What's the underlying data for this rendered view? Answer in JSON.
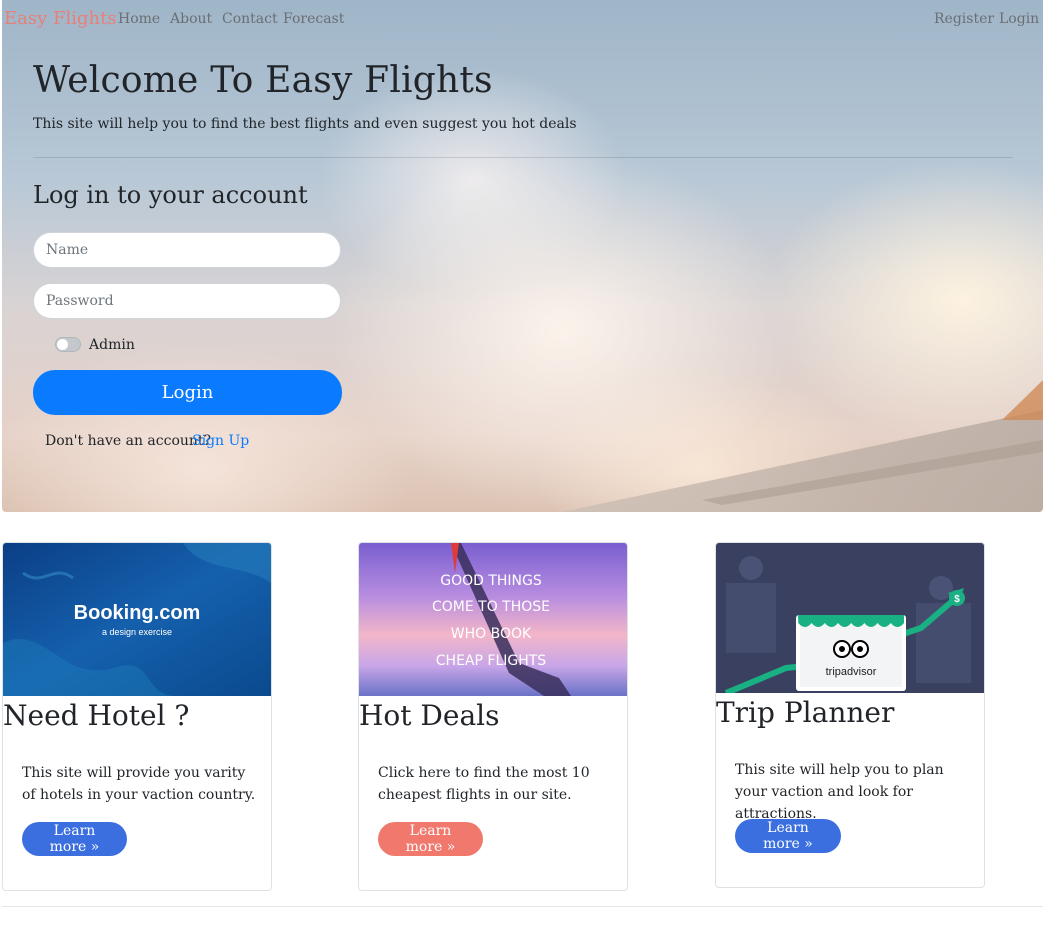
{
  "nav": {
    "brand": "Easy Flights",
    "links": [
      "Home",
      "About",
      "Contact",
      "Forecast"
    ],
    "register": "Register",
    "login": "Login"
  },
  "hero": {
    "title": "Welcome To Easy Flights",
    "lead": "This site will help you to find the best flights and even suggest you hot deals"
  },
  "login_form": {
    "title": "Log in to your account",
    "name_placeholder": "Name",
    "name_value": "",
    "password_placeholder": "Password",
    "password_value": "",
    "admin_label": "Admin",
    "admin_checked": false,
    "submit_label": "Login",
    "no_account_text": "Don't have an account?",
    "signup_label": "Sign Up"
  },
  "cards": [
    {
      "title": "Need Hotel ?",
      "text": "This site will provide you varity of hotels in your vaction country.",
      "button": "Learn more »",
      "image": {
        "logo": "Booking.com",
        "caption": "a design exercise"
      }
    },
    {
      "title": "Hot Deals",
      "text": "Click here to find the most 10 cheapest flights in our site.",
      "button": "Learn more »",
      "image": {
        "lines": [
          "GOOD THINGS",
          "COME TO THOSE",
          "WHO BOOK",
          "CHEAP FLIGHTS"
        ]
      }
    },
    {
      "title": "Trip Planner",
      "text": "This site will help you to plan your vaction and look for attractions.",
      "button": "Learn more »",
      "image": {
        "logo": "tripadvisor"
      }
    }
  ],
  "colors": {
    "brand": "#e78079",
    "primary": "#0a7bff",
    "card_button_blue": "#3b6fe0",
    "card_button_salmon": "#f0786d"
  }
}
